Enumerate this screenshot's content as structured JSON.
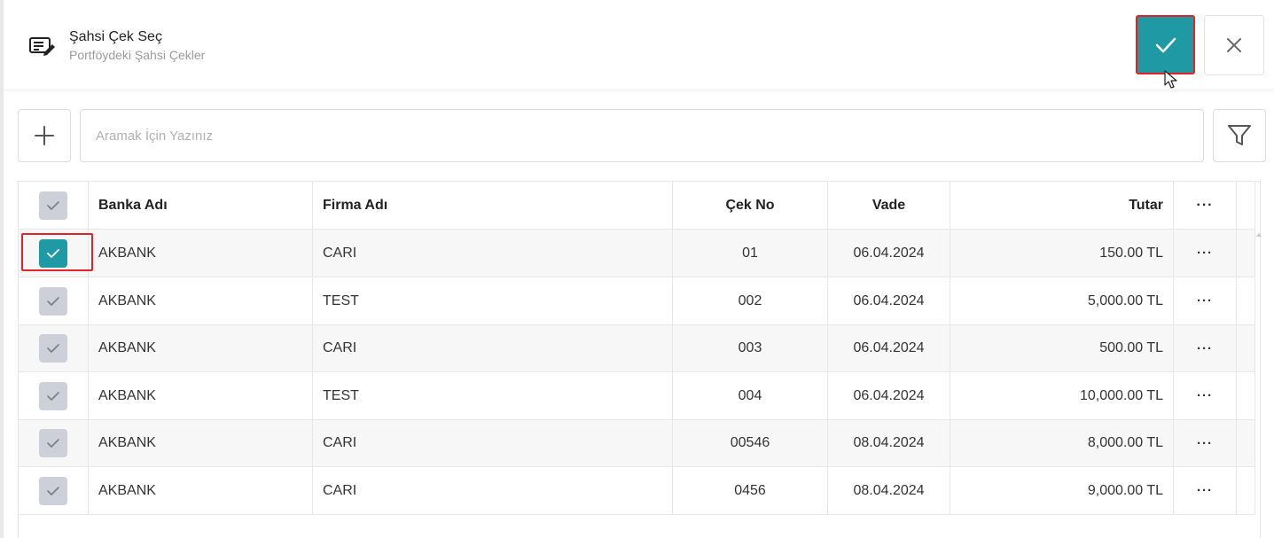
{
  "header": {
    "title": "Şahsi Çek Seç",
    "subtitle": "Portföydeki Şahsi Çekler",
    "icon": "note-edit-icon",
    "confirm_icon": "check-icon",
    "close_icon": "close-icon"
  },
  "toolbar": {
    "add_icon": "plus-icon",
    "search_placeholder": "Aramak İçin Yazınız",
    "search_value": "",
    "filter_icon": "filter-icon"
  },
  "table": {
    "columns": {
      "bank": "Banka Adı",
      "firm": "Firma Adı",
      "check_no": "Çek No",
      "due": "Vade",
      "amount": "Tutar",
      "more": "···"
    },
    "rows": [
      {
        "bank": "AKBANK",
        "firm": "CARI",
        "check_no": "01",
        "due": "06.04.2024",
        "amount": "150.00 TL",
        "more": "···",
        "checked": true
      },
      {
        "bank": "AKBANK",
        "firm": "TEST",
        "check_no": "002",
        "due": "06.04.2024",
        "amount": "5,000.00 TL",
        "more": "···",
        "checked": false
      },
      {
        "bank": "AKBANK",
        "firm": "CARI",
        "check_no": "003",
        "due": "06.04.2024",
        "amount": "500.00 TL",
        "more": "···",
        "checked": false
      },
      {
        "bank": "AKBANK",
        "firm": "TEST",
        "check_no": "004",
        "due": "06.04.2024",
        "amount": "10,000.00 TL",
        "more": "···",
        "checked": false
      },
      {
        "bank": "AKBANK",
        "firm": "CARI",
        "check_no": "00546",
        "due": "08.04.2024",
        "amount": "8,000.00 TL",
        "more": "···",
        "checked": false
      },
      {
        "bank": "AKBANK",
        "firm": "CARI",
        "check_no": "0456",
        "due": "08.04.2024",
        "amount": "9,000.00 TL",
        "more": "···",
        "checked": false
      }
    ]
  },
  "colors": {
    "accent": "#1f9aa5",
    "highlight_outline": "#e0222a",
    "checkbox_unchecked": "#cdd0d8"
  }
}
